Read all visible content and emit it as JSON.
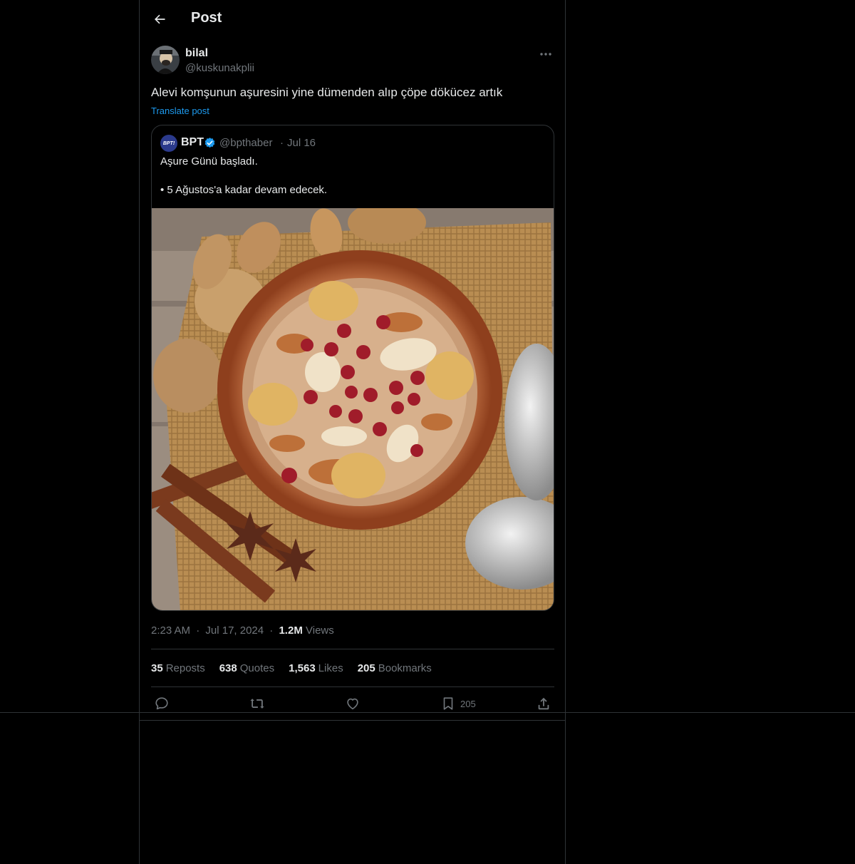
{
  "header": {
    "title": "Post"
  },
  "author": {
    "name": "bilal",
    "handle": "@kuskunakplii"
  },
  "post": {
    "text": "Alevi komşunun aşuresini yine dümenden alıp çöpe dökücez artık",
    "translate_label": "Translate post"
  },
  "quote": {
    "avatar_text": "BPT!",
    "name": "BPT",
    "handle": "@bpthaber",
    "separator": "·",
    "date": "Jul 16",
    "line1": "Aşure Günü başladı.",
    "line2": "• 5 Ağustos'a kadar devam edecek."
  },
  "meta": {
    "time": "2:23 AM",
    "sep1": "·",
    "date": "Jul 17, 2024",
    "sep2": "·",
    "views_count": "1.2M",
    "views_label": "Views"
  },
  "stats": {
    "reposts_count": "35",
    "reposts_label": "Reposts",
    "quotes_count": "638",
    "quotes_label": "Quotes",
    "likes_count": "1,563",
    "likes_label": "Likes",
    "bookmarks_count": "205",
    "bookmarks_label": "Bookmarks"
  },
  "actions": {
    "bookmark_count": "205"
  },
  "colors": {
    "accent": "#1d9bf0",
    "border": "#2f3336",
    "muted": "#71767b",
    "text": "#e7e9ea"
  },
  "icons": [
    "back-arrow-icon",
    "more-icon",
    "verified-badge-icon",
    "reply-icon",
    "repost-icon",
    "like-icon",
    "bookmark-icon",
    "share-icon"
  ]
}
